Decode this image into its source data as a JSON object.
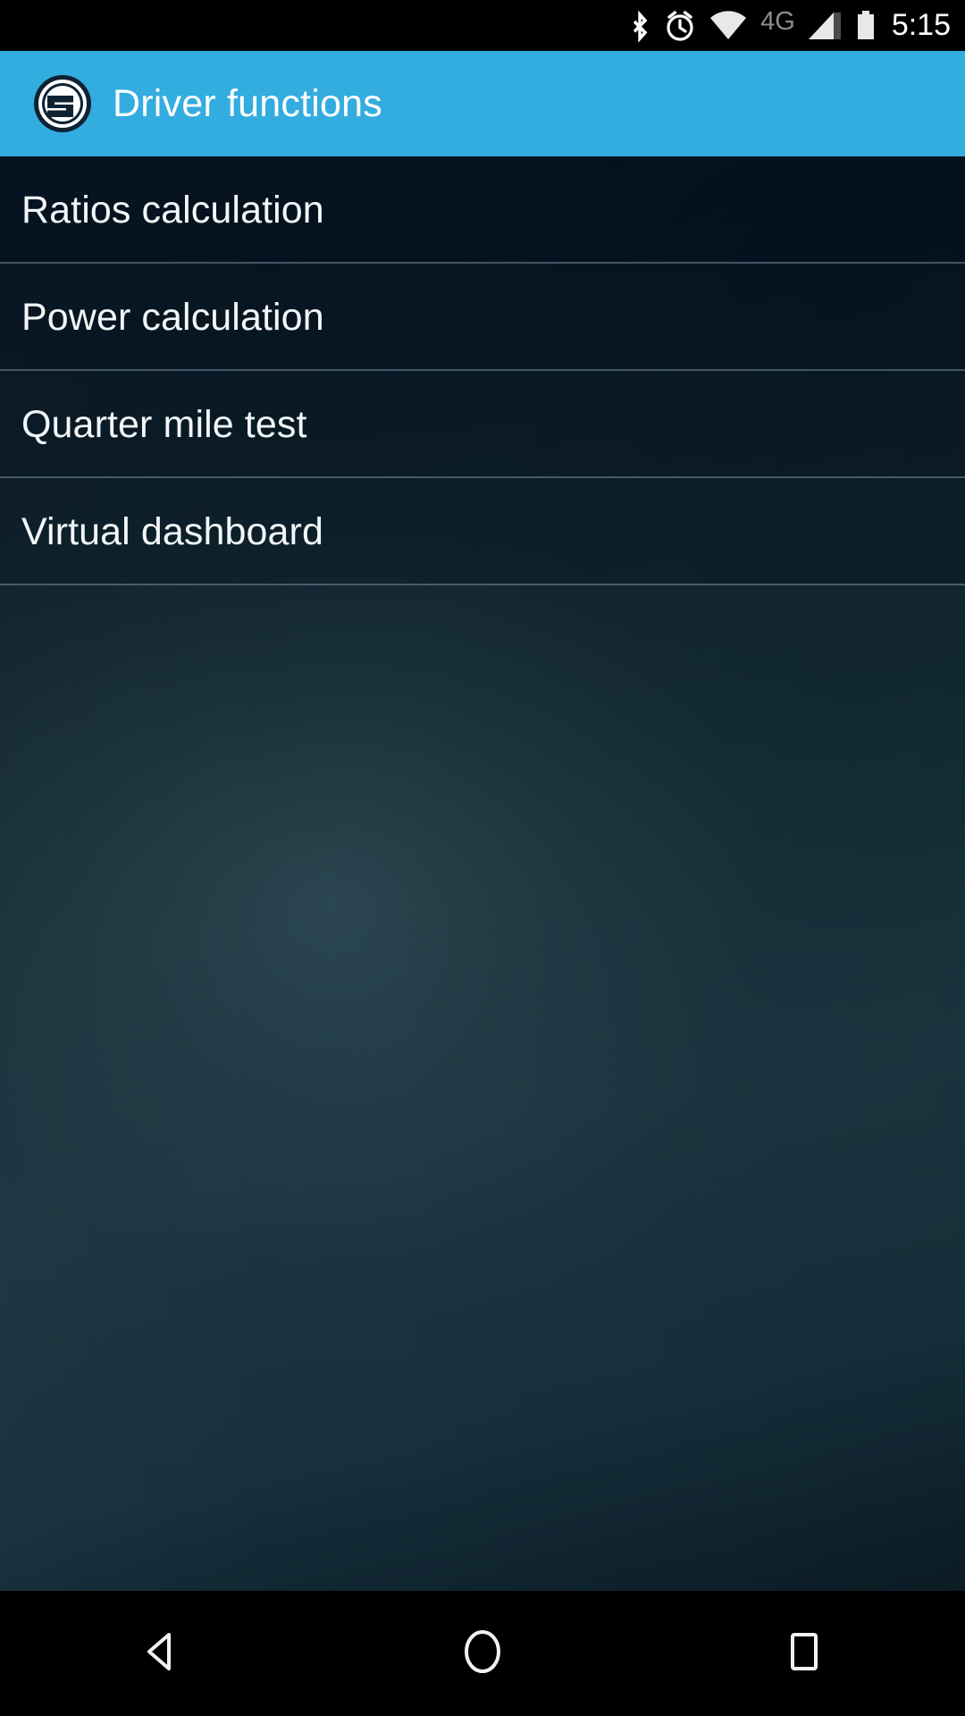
{
  "status_bar": {
    "background_color": "#000000",
    "time": "5:15",
    "network_label": "4G",
    "icons": [
      {
        "name": "bluetooth-icon",
        "label": "Bluetooth"
      },
      {
        "name": "alarm-clock-icon",
        "label": "Alarm"
      },
      {
        "name": "wifi-icon",
        "label": "Wi-Fi"
      },
      {
        "name": "network-4g-label",
        "label": "4G"
      },
      {
        "name": "cellular-signal-icon",
        "label": "Cellular signal"
      },
      {
        "name": "battery-icon",
        "label": "Battery"
      }
    ]
  },
  "app_bar": {
    "title": "Driver functions",
    "background_color": "#33ACE0",
    "title_color": "#FFFFFF",
    "logo": {
      "name": "app-logo-s-emblem",
      "letter": "S",
      "ring_color": "#0E2233",
      "fill_color": "#FFFFFF"
    }
  },
  "menu": {
    "items": [
      {
        "label": "Ratios calculation",
        "name": "menu-item-ratios-calculation"
      },
      {
        "label": "Power calculation",
        "name": "menu-item-power-calculation"
      },
      {
        "label": "Quarter mile test",
        "name": "menu-item-quarter-mile-test"
      },
      {
        "label": "Virtual dashboard",
        "name": "menu-item-virtual-dashboard"
      }
    ],
    "text_color": "#F2F6F8",
    "divider_color": "#96B2BE"
  },
  "navigation_bar": {
    "background_color": "#000000",
    "buttons": [
      {
        "label": "Back",
        "name": "nav-back-button"
      },
      {
        "label": "Home",
        "name": "nav-home-button"
      },
      {
        "label": "Recents",
        "name": "nav-recents-button"
      }
    ]
  }
}
